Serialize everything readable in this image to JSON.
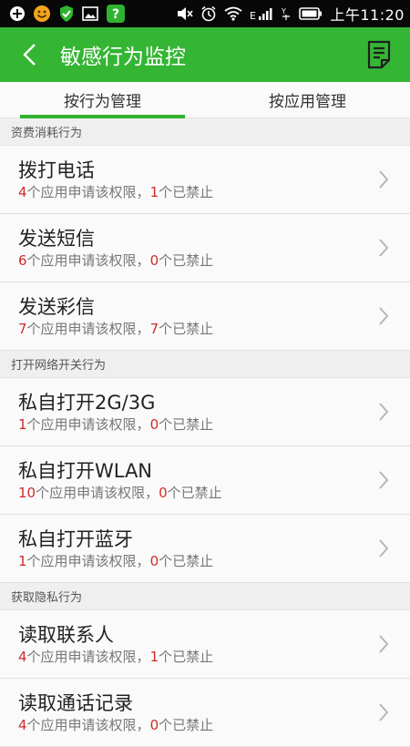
{
  "status_bar": {
    "time": "上午11:20",
    "left_icons": [
      "plus-circle-icon",
      "smiley-icon",
      "shield-icon",
      "image-icon",
      "question-icon"
    ],
    "right_icons": [
      "mute-icon",
      "alarm-icon",
      "wifi-icon",
      "signal-icon",
      "sim-icon",
      "battery-icon"
    ],
    "signal_label": "E",
    "sim_label": "Y"
  },
  "header": {
    "title": "敏感行为监控",
    "bg_color": "#34b534"
  },
  "tabs": [
    {
      "label": "按行为管理",
      "active": true
    },
    {
      "label": "按应用管理",
      "active": false
    }
  ],
  "sections": [
    {
      "title": "资费消耗行为",
      "items": [
        {
          "title": "拨打电话",
          "apps": "4",
          "apps_text": "个应用申请该权限，",
          "blocked": "1",
          "blocked_text": "个已禁止"
        },
        {
          "title": "发送短信",
          "apps": "6",
          "apps_text": "个应用申请该权限，",
          "blocked": "0",
          "blocked_text": "个已禁止"
        },
        {
          "title": "发送彩信",
          "apps": "7",
          "apps_text": "个应用申请该权限，",
          "blocked": "7",
          "blocked_text": "个已禁止"
        }
      ]
    },
    {
      "title": "打开网络开关行为",
      "items": [
        {
          "title": "私自打开2G/3G",
          "apps": "1",
          "apps_text": "个应用申请该权限，",
          "blocked": "0",
          "blocked_text": "个已禁止"
        },
        {
          "title": "私自打开WLAN",
          "apps": "10",
          "apps_text": "个应用申请该权限，",
          "blocked": "0",
          "blocked_text": "个已禁止"
        },
        {
          "title": "私自打开蓝牙",
          "apps": "1",
          "apps_text": "个应用申请该权限，",
          "blocked": "0",
          "blocked_text": "个已禁止"
        }
      ]
    },
    {
      "title": "获取隐私行为",
      "items": [
        {
          "title": "读取联系人",
          "apps": "4",
          "apps_text": "个应用申请该权限，",
          "blocked": "1",
          "blocked_text": "个已禁止"
        },
        {
          "title": "读取通话记录",
          "apps": "4",
          "apps_text": "个应用申请该权限，",
          "blocked": "0",
          "blocked_text": "个已禁止"
        }
      ]
    }
  ],
  "colors": {
    "accent": "#2fb32f",
    "count_red": "#d22a2a"
  }
}
